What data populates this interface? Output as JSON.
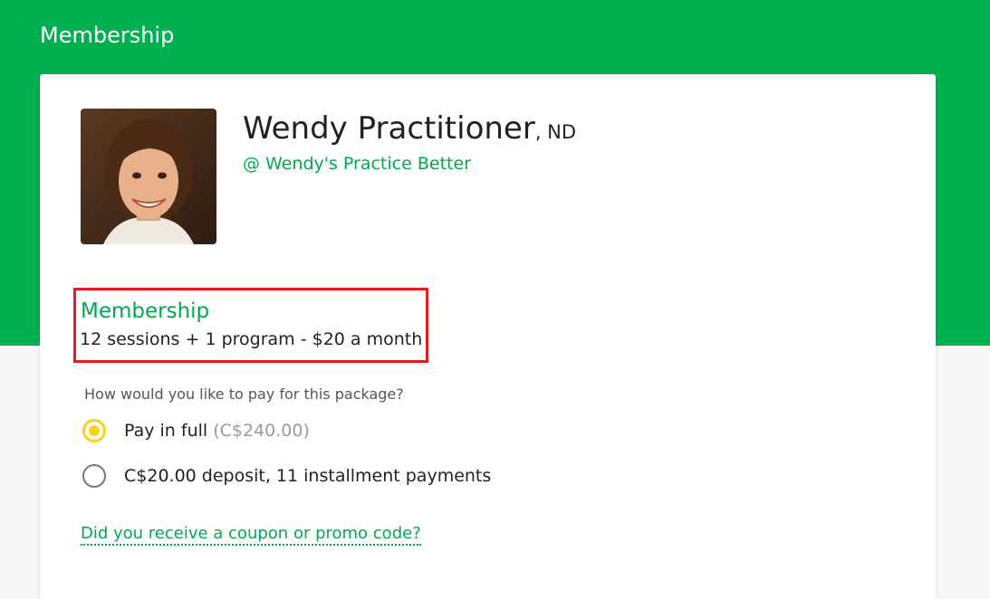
{
  "header": {
    "title": "Membership"
  },
  "practitioner": {
    "name": "Wendy Practitioner",
    "credential": ", ND",
    "practice": "@ Wendy's Practice Better"
  },
  "package": {
    "name": "Membership",
    "description": "12 sessions + 1 program - $20 a month"
  },
  "payment": {
    "question": "How would you like to pay for this package?",
    "options": [
      {
        "label": "Pay in full",
        "amount": "(C$240.00)",
        "selected": true
      },
      {
        "label": "C$20.00 deposit, 11 installment payments",
        "selected": false
      }
    ]
  },
  "coupon": {
    "link": "Did you receive a coupon or promo code?"
  },
  "colors": {
    "brand": "#00b050",
    "link": "#00a94f",
    "radio_selected": "#f7d21b",
    "highlight": "#e01b24"
  }
}
